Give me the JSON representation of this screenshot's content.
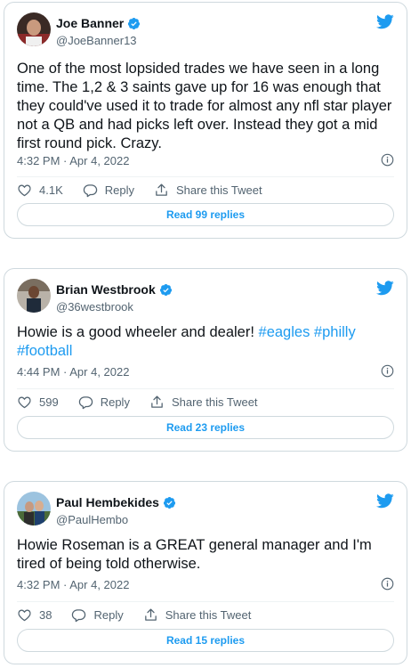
{
  "tweets": [
    {
      "author": "Joe Banner",
      "handle": "@JoeBanner13",
      "text_plain": "One of the most lopsided trades we have seen in a long time. The 1,2 & 3 saints gave up for 16 was enough that they could've used it to trade for almost any nfl star player not a QB and had picks left over. Instead they got a mid first round pick. Crazy.",
      "timestamp": "4:32 PM · Apr 4, 2022",
      "likes": "4.1K",
      "reply_label": "Reply",
      "share_label": "Share this Tweet",
      "read_replies": "Read 99 replies"
    },
    {
      "author": "Brian Westbrook",
      "handle": "@36westbrook",
      "text_plain": "Howie is a good wheeler and dealer! ",
      "hashtags": [
        "#eagles",
        "#philly",
        "#football"
      ],
      "timestamp": "4:44 PM · Apr 4, 2022",
      "likes": "599",
      "reply_label": "Reply",
      "share_label": "Share this Tweet",
      "read_replies": "Read 23 replies"
    },
    {
      "author": "Paul Hembekides",
      "handle": "@PaulHembo",
      "text_plain": "Howie Roseman is a GREAT general manager and I'm tired of being told otherwise.",
      "timestamp": "4:32 PM · Apr 4, 2022",
      "likes": "38",
      "reply_label": "Reply",
      "share_label": "Share this Tweet",
      "read_replies": "Read 15 replies"
    }
  ],
  "colors": {
    "accent": "#1d9bf0",
    "text": "#0f1419",
    "muted": "#536471",
    "border": "#cfd9de"
  },
  "icons": [
    "verified-badge-icon",
    "twitter-bird-icon",
    "info-icon",
    "heart-icon",
    "reply-icon",
    "share-icon"
  ]
}
